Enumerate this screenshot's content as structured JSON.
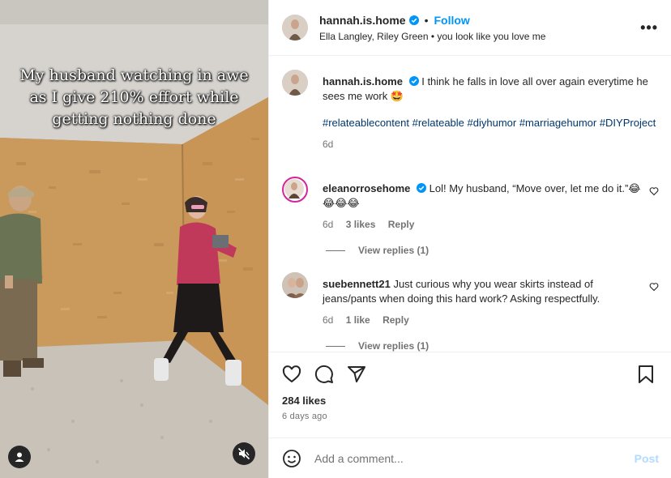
{
  "media": {
    "overlay_lines": [
      "My husband watching in awe",
      "as I give 210% effort while",
      "getting nothing done"
    ],
    "profile_icon": "user-circle-icon",
    "mute_icon": "speaker-muted-icon"
  },
  "header": {
    "username": "hannah.is.home",
    "verified_icon": "verified-badge-icon",
    "separator": "•",
    "follow_label": "Follow",
    "audio_text": "Ella Langley, Riley Green • you look like you love me",
    "more_label": "•••"
  },
  "caption": {
    "username": "hannah.is.home",
    "text": "I think he falls in love all over again everytime he sees me work 🤩",
    "hashtags": "#relateablecontent #relateable #diyhumor #marriagehumor #DIYProject",
    "time": "6d"
  },
  "comments": [
    {
      "username": "eleanorrosehome",
      "text": "Lol! My husband, “Move over, let me do it.”😂😂😂😂",
      "time": "6d",
      "likes": "3 likes",
      "reply_label": "Reply",
      "view_replies": "View replies (1)"
    },
    {
      "username": "suebennett21",
      "text": "Just curious why you wear skirts instead of jeans/pants when doing this hard work? Asking respectfully.",
      "time": "6d",
      "likes": "1 like",
      "reply_label": "Reply",
      "view_replies": "View replies (1)"
    }
  ],
  "actions": {
    "likes": "284 likes",
    "ago": "6 days ago"
  },
  "add_comment": {
    "placeholder": "Add a comment...",
    "post_label": "Post"
  },
  "colors": {
    "accent": "#0095f6",
    "hashtag": "#00376b",
    "muted_text": "#737373",
    "post_disabled": "#b3dbff"
  }
}
